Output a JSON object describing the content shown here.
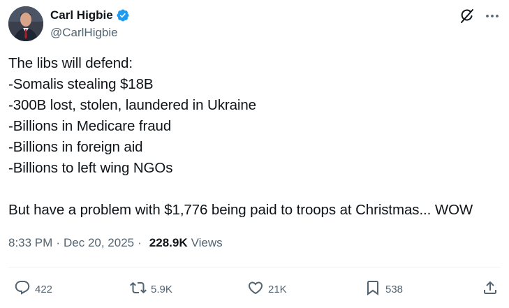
{
  "author": {
    "display_name": "Carl Higbie",
    "handle": "@CarlHigbie",
    "verified": true,
    "verified_color": "#1d9bf0"
  },
  "tweet": {
    "lines": [
      "The libs will defend:",
      "-Somalis stealing $18B",
      "-300B lost, stolen, laundered in Ukraine",
      "-Billions in Medicare fraud",
      "-Billions in foreign aid",
      "-Billions to left wing NGOs",
      "",
      "But have a problem with $1,776 being paid to troops at Christmas... WOW"
    ]
  },
  "meta": {
    "time": "8:33 PM",
    "separator": "·",
    "date": "Dec 20, 2025",
    "views_count": "228.9K",
    "views_label": "Views"
  },
  "actions": {
    "replies": "422",
    "reposts": "5.9K",
    "likes": "21K",
    "bookmarks": "538"
  },
  "icons": {
    "grok": "grok-icon",
    "more": "more-icon",
    "reply": "reply-icon",
    "repost": "repost-icon",
    "like": "heart-icon",
    "bookmark": "bookmark-icon",
    "share": "share-icon"
  },
  "colors": {
    "text": "#0f1419",
    "secondary": "#536471",
    "verified": "#1d9bf0",
    "divider": "#eff3f4"
  }
}
